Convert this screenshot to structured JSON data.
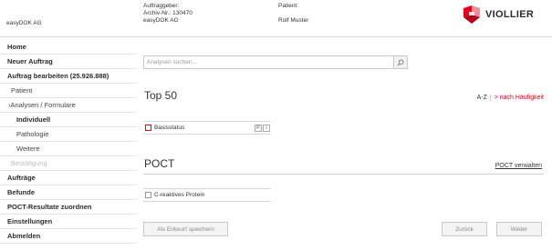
{
  "header": {
    "company": "easyDOK AG",
    "auftraggeber_label": "Auftraggeber:",
    "archiv_nr": "Archiv-Nr.: 130470",
    "auftraggeber_name": "easyDOK AG",
    "patient_label": "Patient:",
    "patient_name": "Rolf Muster",
    "logo_text": "VIOLLIER",
    "logo_color": "#e2001a"
  },
  "sidebar": {
    "items": [
      {
        "label": "Home"
      },
      {
        "label": "Neuer Auftrag"
      },
      {
        "label": "Auftrag bearbeiten (25.926.888)"
      },
      {
        "label": "Patient"
      },
      {
        "label": "›Analysen / Formulare"
      },
      {
        "label": "Individuell"
      },
      {
        "label": "Pathologie"
      },
      {
        "label": "Weitere"
      },
      {
        "label": "Bestätigung"
      },
      {
        "label": "Aufträge"
      },
      {
        "label": "Befunde"
      },
      {
        "label": "POCT-Resultate zuordnen"
      },
      {
        "label": "Einstellungen"
      },
      {
        "label": "Abmelden"
      }
    ]
  },
  "search": {
    "placeholder": "Analysen suchen...",
    "value": "",
    "icon": "search-icon"
  },
  "top50": {
    "title": "Top 50",
    "sort_az": "A-Z",
    "sort_separator": "|",
    "sort_frequency": "> nach Häufigkeit",
    "items": [
      {
        "label": "Basisstatus",
        "badge_p": "P",
        "badge_i": "i"
      }
    ]
  },
  "poct": {
    "title": "POCT",
    "manage_link": "POCT verwalten",
    "items": [
      {
        "label": "C-reaktives Protein"
      }
    ]
  },
  "buttons": {
    "save_draft": "Als Entwurf speichern",
    "back": "Zurück",
    "next": "Weiter"
  },
  "colors": {
    "accent": "#e2001a",
    "border": "#c9c9c9",
    "disabled_text": "#bbbbbb"
  }
}
